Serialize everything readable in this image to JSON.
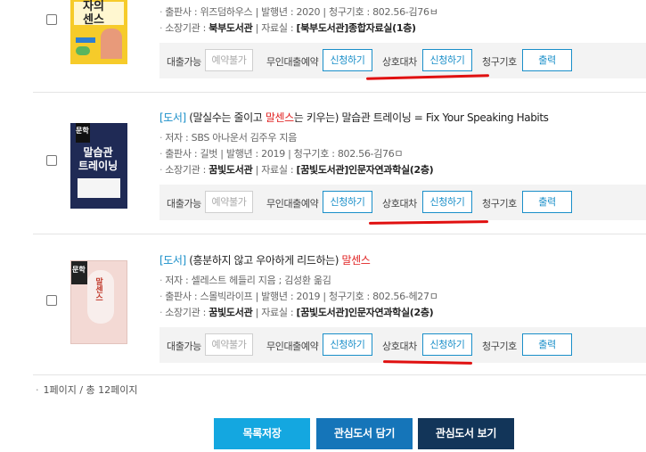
{
  "results": [
    {
      "type_tag": "",
      "title_pre": "",
      "title_hl": "",
      "title_post": "",
      "cover_text": "자의\n센스",
      "author": "",
      "publisher_line": "출판사 : 위즈덤하우스  | 발행년 : 2020 | 청구기호 : 802.56-김76ㅂ",
      "location_label": "소장기관 : ",
      "location_value": "북부도서관",
      "room_label": " | 자료실 : ",
      "room_value": "[북부도서관]종합자료실(1층)"
    },
    {
      "type_tag": "[도서]",
      "title_pre": " (말실수는 줄이고 ",
      "title_hl": "말센스",
      "title_post": "는 키우는) 말습관 트레이닝 = Fix Your Speaking Habits",
      "cover_badge": "문학",
      "cover_text": "말습관\n트레이닝",
      "author": "저자 : SBS 아나운서 김주우 지음",
      "publisher_line": "출판사 : 길벗  | 발행년 : 2019 | 청구기호 : 802.56-김76ㅁ",
      "location_label": "소장기관 : ",
      "location_value": "꿈빛도서관",
      "room_label": " | 자료실 : ",
      "room_value": "[꿈빛도서관]인문자연과학실(2층)"
    },
    {
      "type_tag": "[도서]",
      "title_pre": " (흥분하지 않고 우아하게 리드하는) ",
      "title_hl": "말센스",
      "title_post": "",
      "cover_badge": "문학",
      "cover_text": "말센스",
      "author": "저자 : 셀레스트 헤들리 지음 ; 김성환 옮김",
      "publisher_line": "출판사 : 스몰빅라이프  | 발행년 : 2019 | 청구기호 : 802.56-헤27ㅁ",
      "location_label": "소장기관 : ",
      "location_value": "꿈빛도서관",
      "room_label": " | 자료실 : ",
      "room_value": "[꿈빛도서관]인문자연과학실(2층)"
    }
  ],
  "actions": {
    "loan_label": "대출가능",
    "reserve_btn": "예약불가",
    "unmanned_label": "무인대출예약",
    "apply_btn": "신청하기",
    "interlib_label": "상호대차",
    "callno_label": "청구기호",
    "print_btn": "출력"
  },
  "pager": {
    "text": "1페이지 / 총 12페이지"
  },
  "bottom": {
    "save_list": "목록저장",
    "add_favorite": "관심도서 담기",
    "view_favorite": "관심도서 보기"
  },
  "colors": {
    "link": "#1a8fc9",
    "highlight": "#e02020",
    "annotation": "#e01010"
  }
}
